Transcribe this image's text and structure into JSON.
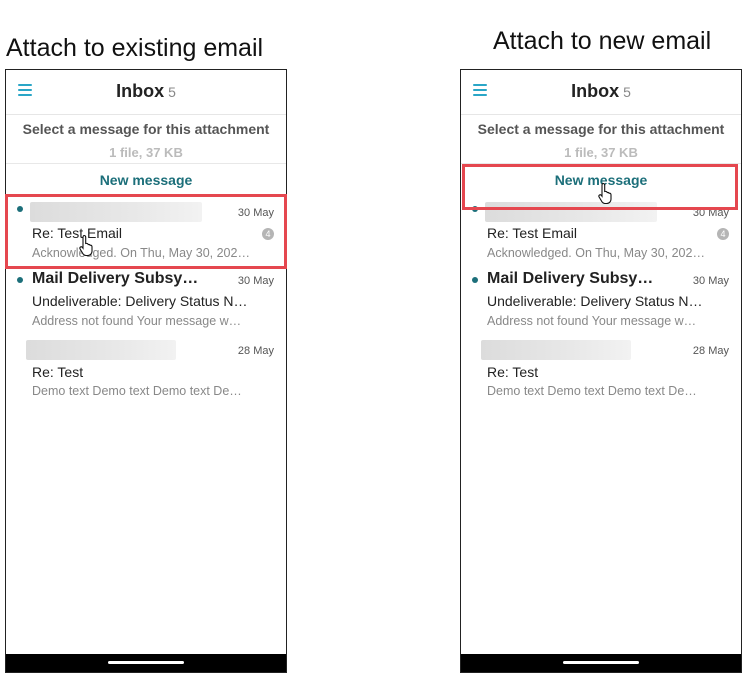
{
  "left_panel": {
    "caption": "Attach to existing email",
    "inbox_title": "Inbox",
    "inbox_count": "5",
    "select_prompt": "Select a message for this attachment",
    "file_info": "1 file, 37 KB",
    "new_message_label": "New message",
    "emails": [
      {
        "date": "30 May",
        "subject": "Re: Test Email",
        "preview": "Acknowledged. On Thu, May 30, 202…",
        "badge": "4"
      },
      {
        "sender": "Mail Delivery Subsy…",
        "date": "30 May",
        "subject": "Undeliverable: Delivery Status N…",
        "preview": "Address not found Your message w…"
      },
      {
        "date": "28 May",
        "subject": "Re: Test",
        "preview": "Demo text Demo text Demo text De…"
      }
    ]
  },
  "right_panel": {
    "caption": "Attach to new email",
    "inbox_title": "Inbox",
    "inbox_count": "5",
    "select_prompt": "Select a message for this attachment",
    "file_info": "1 file, 37 KB",
    "new_message_label": "New message",
    "emails": [
      {
        "date": "30 May",
        "subject": "Re: Test Email",
        "preview": "Acknowledged. On Thu, May 30, 202…",
        "badge": "4"
      },
      {
        "sender": "Mail Delivery Subsy…",
        "date": "30 May",
        "subject": "Undeliverable: Delivery Status N…",
        "preview": "Address not found Your message w…"
      },
      {
        "date": "28 May",
        "subject": "Re: Test",
        "preview": "Demo text Demo text Demo text De…"
      }
    ]
  },
  "colors": {
    "accent": "#1c6f7a",
    "highlight": "#e5474f",
    "menu": "#2aa6c7"
  }
}
